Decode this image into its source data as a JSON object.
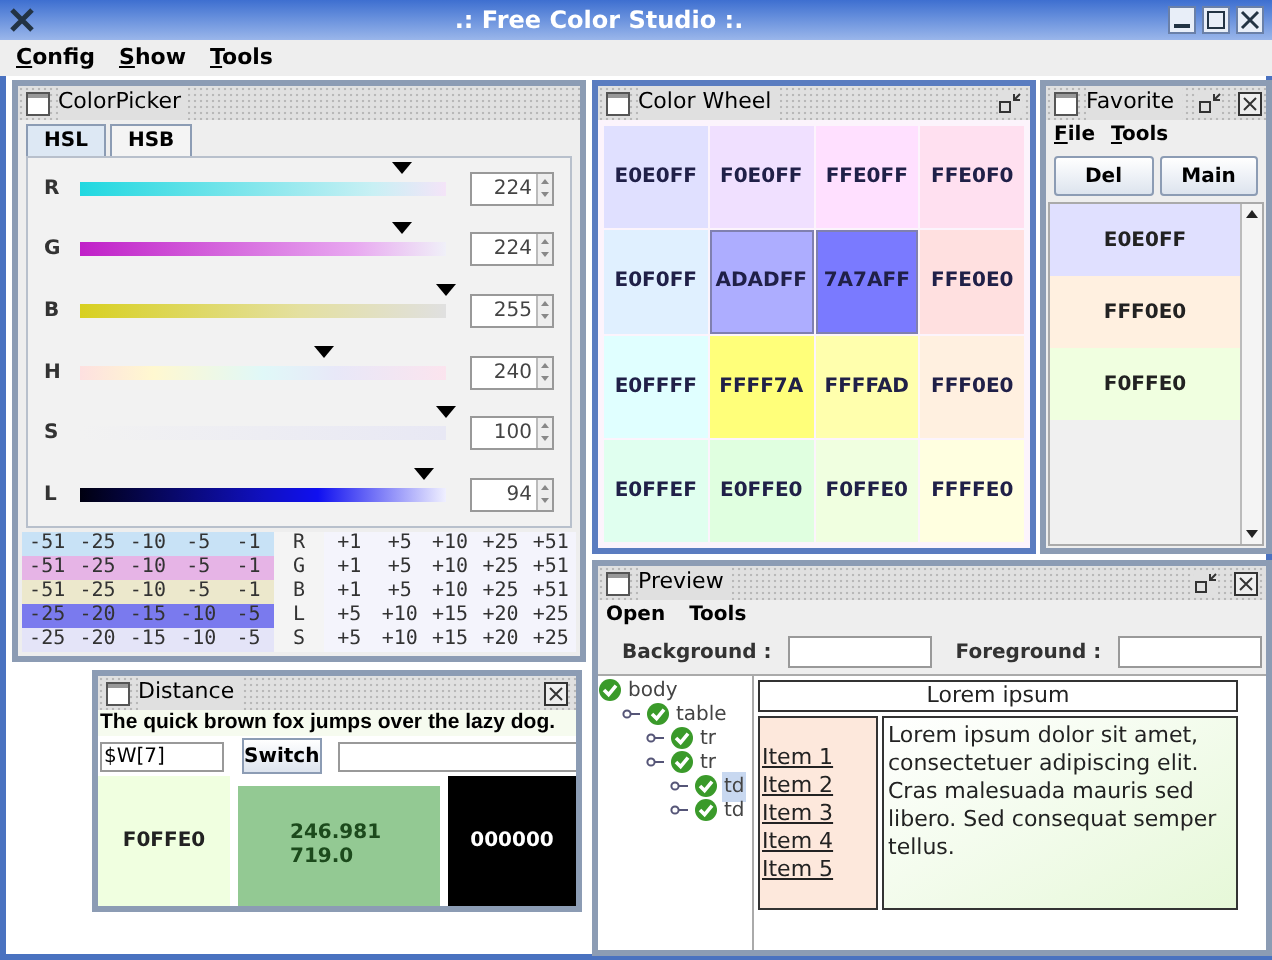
{
  "app": {
    "title": ".: Free Color Studio :."
  },
  "menu": [
    "Config",
    "Show",
    "Tools"
  ],
  "color_picker": {
    "title": "ColorPicker",
    "tabs": [
      {
        "label": "HSL",
        "selected": true
      },
      {
        "label": "HSB",
        "selected": false
      }
    ],
    "sliders": [
      {
        "label": "R",
        "value": "224",
        "level": 0.878
      },
      {
        "label": "G",
        "value": "224",
        "level": 0.878
      },
      {
        "label": "B",
        "value": "255",
        "level": 1.0
      },
      {
        "label": "H",
        "value": "240",
        "level": 0.667
      },
      {
        "label": "S",
        "value": "100",
        "level": 1.0
      },
      {
        "label": "L",
        "value": "94",
        "level": 0.94
      }
    ],
    "adjust_rows": [
      {
        "label": "R",
        "color": "#c8e2f6",
        "minus": [
          "-51",
          "-25",
          "-10",
          "-5",
          "-1"
        ],
        "plus": [
          "+1",
          "+5",
          "+10",
          "+25",
          "+51"
        ]
      },
      {
        "label": "G",
        "color": "#e6b4e6",
        "minus": [
          "-51",
          "-25",
          "-10",
          "-5",
          "-1"
        ],
        "plus": [
          "+1",
          "+5",
          "+10",
          "+25",
          "+51"
        ]
      },
      {
        "label": "B",
        "color": "#ece8cc",
        "minus": [
          "-51",
          "-25",
          "-10",
          "-5",
          "-1"
        ],
        "plus": [
          "+1",
          "+5",
          "+10",
          "+25",
          "+51"
        ]
      },
      {
        "label": "L",
        "color": "#7a7aee",
        "minus": [
          "-25",
          "-20",
          "-15",
          "-10",
          "-5"
        ],
        "plus": [
          "+5",
          "+10",
          "+15",
          "+20",
          "+25"
        ]
      },
      {
        "label": "S",
        "color": "#e4e4f8",
        "minus": [
          "-25",
          "-20",
          "-15",
          "-10",
          "-5"
        ],
        "plus": [
          "+5",
          "+10",
          "+15",
          "+20",
          "+25"
        ]
      }
    ]
  },
  "color_wheel": {
    "title": "Color Wheel",
    "swatches": [
      {
        "label": "E0E0FF",
        "color": "#e0e0ff",
        "selected": false
      },
      {
        "label": "F0E0FF",
        "color": "#f0e0ff",
        "selected": false
      },
      {
        "label": "FFE0FF",
        "color": "#ffe0ff",
        "selected": false
      },
      {
        "label": "FFE0F0",
        "color": "#ffe0f0",
        "selected": false
      },
      {
        "label": "E0F0FF",
        "color": "#e0f0ff",
        "selected": false
      },
      {
        "label": "ADADFF",
        "color": "#adadff",
        "selected": true
      },
      {
        "label": "7A7AFF",
        "color": "#7a7aff",
        "selected": true
      },
      {
        "label": "FFE0E0",
        "color": "#ffe0e0",
        "selected": false
      },
      {
        "label": "E0FFFF",
        "color": "#e0ffff",
        "selected": false
      },
      {
        "label": "FFFF7A",
        "color": "#ffff7a",
        "selected": false
      },
      {
        "label": "FFFFAD",
        "color": "#ffffad",
        "selected": false
      },
      {
        "label": "FFF0E0",
        "color": "#fff0e0",
        "selected": false
      },
      {
        "label": "E0FFEF",
        "color": "#e0ffef",
        "selected": false
      },
      {
        "label": "E0FFE0",
        "color": "#e0ffe0",
        "selected": false
      },
      {
        "label": "F0FFE0",
        "color": "#f0ffe0",
        "selected": false
      },
      {
        "label": "FFFFE0",
        "color": "#ffffe0",
        "selected": false
      }
    ]
  },
  "favorite": {
    "title": "Favorite",
    "menu": [
      "File",
      "Tools"
    ],
    "buttons": [
      "Del",
      "Main"
    ],
    "items": [
      {
        "label": "E0E0FF",
        "color": "#e0e0ff"
      },
      {
        "label": "FFF0E0",
        "color": "#fff0e0"
      },
      {
        "label": "F0FFE0",
        "color": "#f0ffe0"
      }
    ]
  },
  "preview": {
    "title": "Preview",
    "menu": [
      "Open",
      "Tools"
    ],
    "background_label": "Background :",
    "foreground_label": "Foreground :",
    "tree": [
      {
        "label": "body",
        "selected": false,
        "children": [
          {
            "label": "table",
            "selected": false,
            "children": [
              {
                "label": "tr",
                "selected": false
              },
              {
                "label": "tr",
                "selected": false,
                "children": [
                  {
                    "label": "td",
                    "selected": true
                  },
                  {
                    "label": "td",
                    "selected": false
                  }
                ]
              }
            ]
          }
        ]
      }
    ],
    "heading": "Lorem ipsum",
    "links": [
      "Item 1",
      "Item 2",
      "Item 3",
      "Item 4",
      "Item 5"
    ],
    "paragraph": "Lorem ipsum dolor sit amet, consectetuer adipiscing elit. Cras malesuada mauris sed libero. Sed consequat semper tellus."
  },
  "distance": {
    "title": "Distance",
    "sentence": "The quick brown fox jumps over the lazy dog.",
    "input": "$W[7]",
    "button": "Switch",
    "panels": [
      {
        "kind": "swatch",
        "color": "#f0ffe0",
        "lines": [
          "F0FFE0"
        ]
      },
      {
        "kind": "result",
        "color": "#93c993",
        "lines": [
          "246.981",
          "719.0"
        ]
      },
      {
        "kind": "swatch",
        "color": "#000000",
        "lines": [
          "000000"
        ]
      }
    ]
  }
}
